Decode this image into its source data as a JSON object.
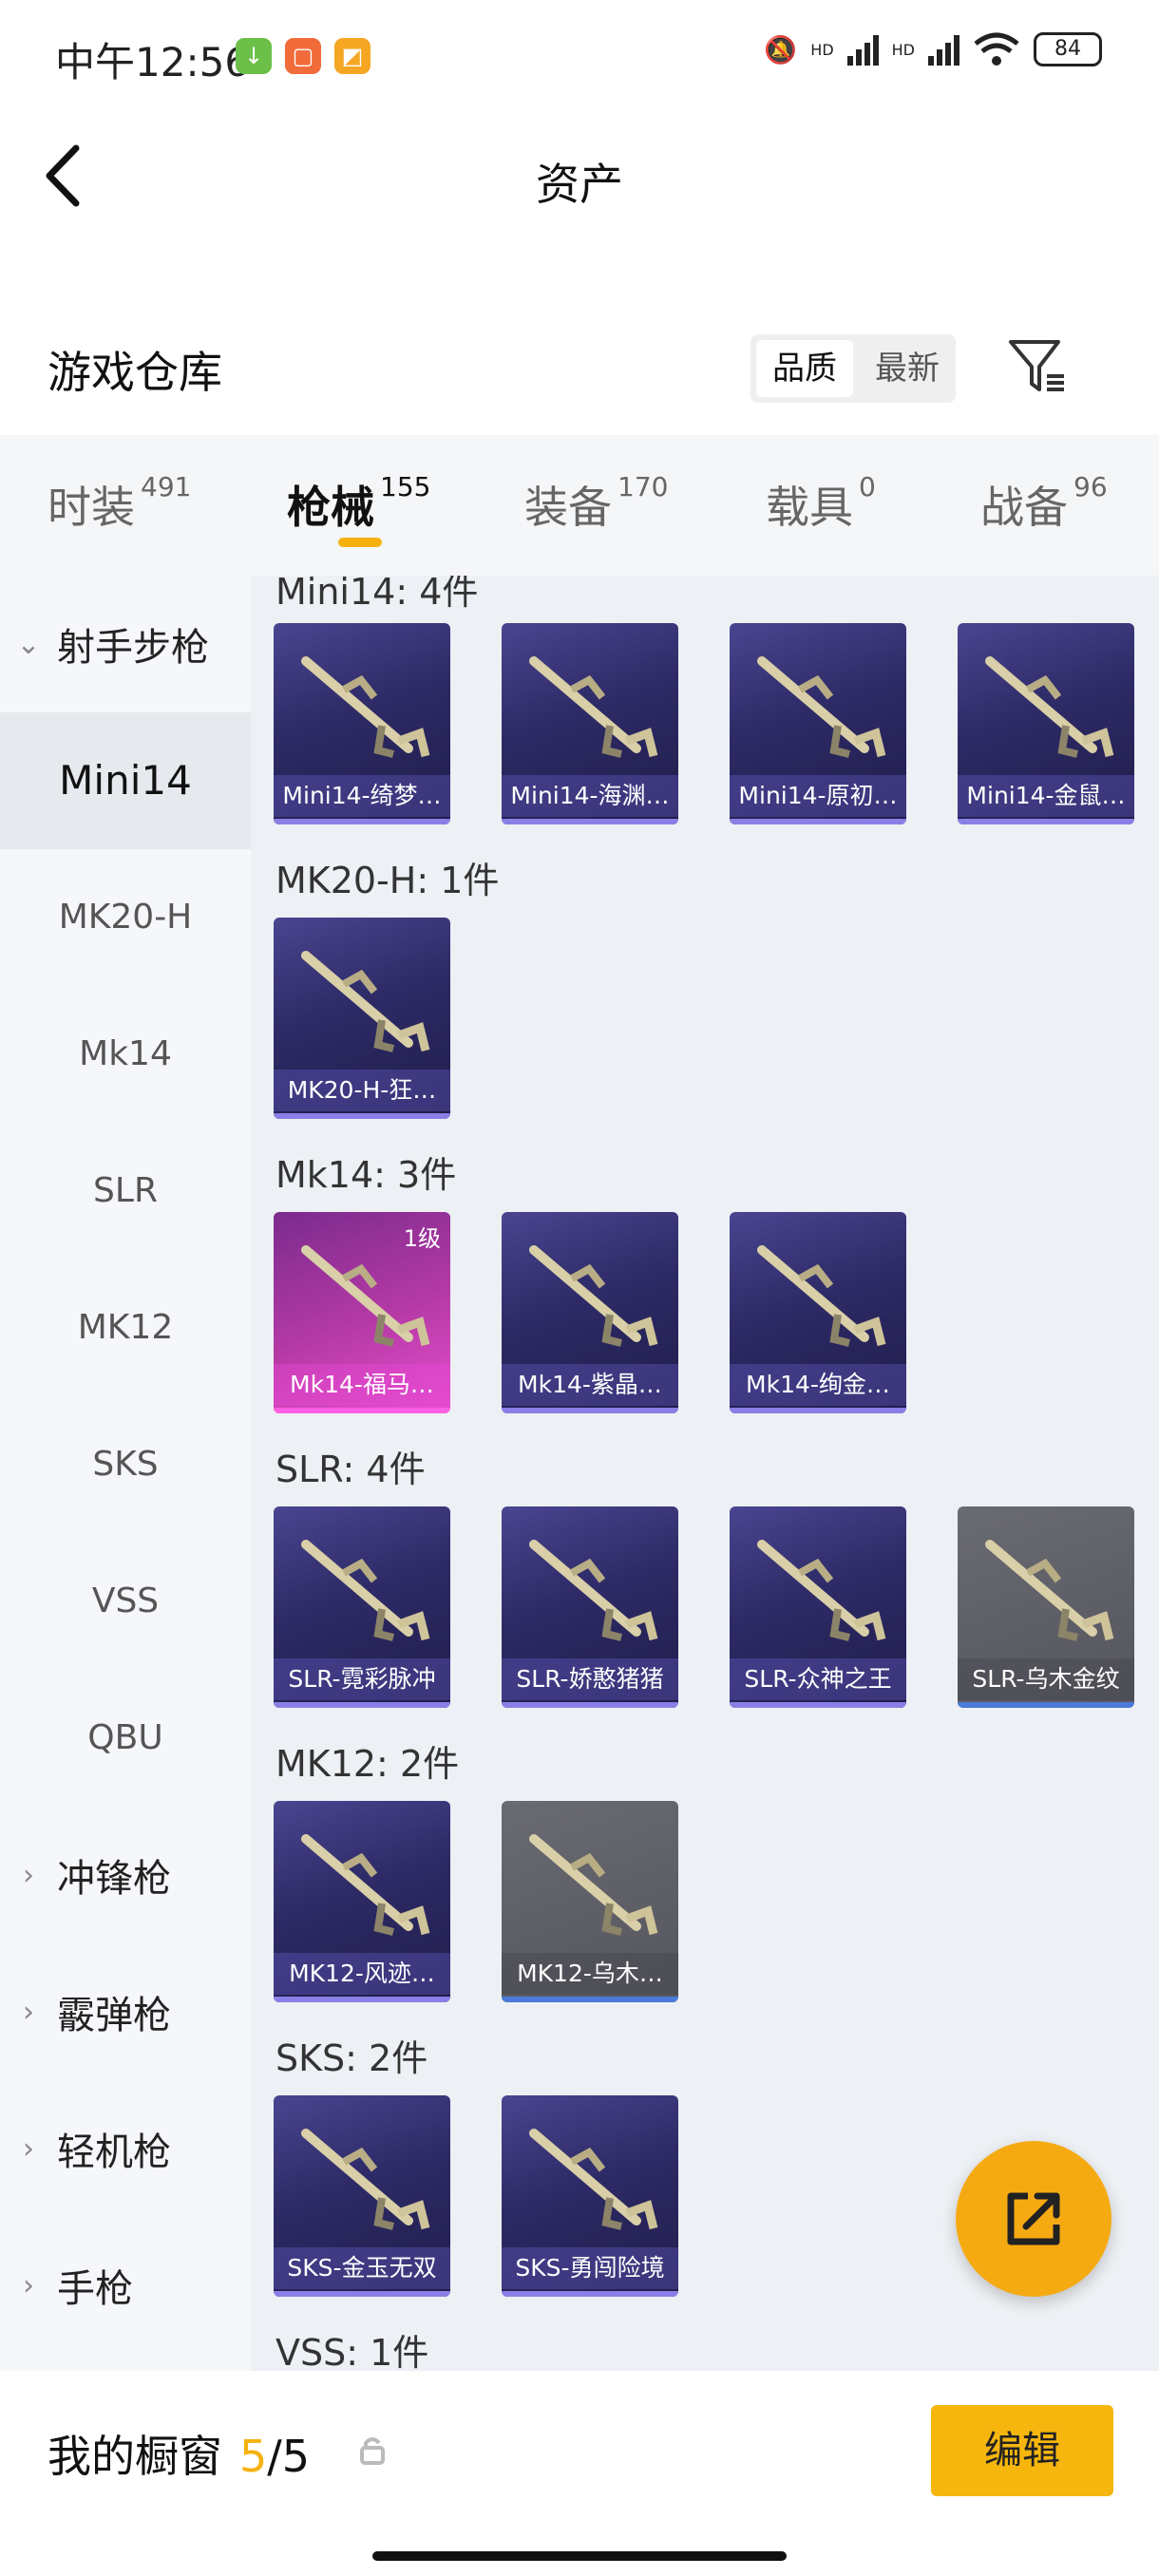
{
  "status": {
    "time": "中午12:56",
    "battery": "84",
    "hd1": "HD",
    "hd2": "HD"
  },
  "header": {
    "title": "资产"
  },
  "warehouse": {
    "title": "游戏仓库",
    "sort_quality": "品质",
    "sort_latest": "最新"
  },
  "tabs": [
    {
      "label": "时装",
      "count": "491"
    },
    {
      "label": "枪械",
      "count": "155"
    },
    {
      "label": "装备",
      "count": "170"
    },
    {
      "label": "载具",
      "count": "0"
    },
    {
      "label": "战备",
      "count": "96"
    }
  ],
  "sidebar": {
    "cat_marksman": "射手步枪",
    "subs": [
      "Mini14",
      "MK20-H",
      "Mk14",
      "SLR",
      "MK12",
      "SKS",
      "VSS",
      "QBU"
    ],
    "cats": [
      "冲锋枪",
      "霰弹枪",
      "轻机枪",
      "手枪"
    ]
  },
  "groups": [
    {
      "title": "Mini14: 4件",
      "items": [
        "Mini14-绮梦…",
        "Mini14-海渊…",
        "Mini14-原初…",
        "Mini14-金鼠…"
      ]
    },
    {
      "title": "MK20-H: 1件",
      "items": [
        "MK20-H-狂…"
      ]
    },
    {
      "title": "Mk14: 3件",
      "items": [
        "Mk14-福马…",
        "Mk14-紫晶…",
        "Mk14-绚金…"
      ],
      "level_badge": "1级"
    },
    {
      "title": "SLR: 4件",
      "items": [
        "SLR-霓彩脉冲",
        "SLR-娇憨猪猪",
        "SLR-众神之王",
        "SLR-乌木金纹"
      ]
    },
    {
      "title": "MK12: 2件",
      "items": [
        "MK12-风迹…",
        "MK12-乌木…"
      ]
    },
    {
      "title": "SKS: 2件",
      "items": [
        "SKS-金玉无双",
        "SKS-勇闯险境"
      ]
    },
    {
      "title": "VSS: 1件",
      "items": []
    }
  ],
  "bottom": {
    "showcase_label": "我的橱窗",
    "showcase_current": "5",
    "showcase_total": "/5",
    "edit_label": "编辑"
  },
  "colors": {
    "accent": "#f5b110",
    "card_purple": "#2d2a66",
    "card_pink": "#e64fd0",
    "card_gray": "#55565d"
  }
}
